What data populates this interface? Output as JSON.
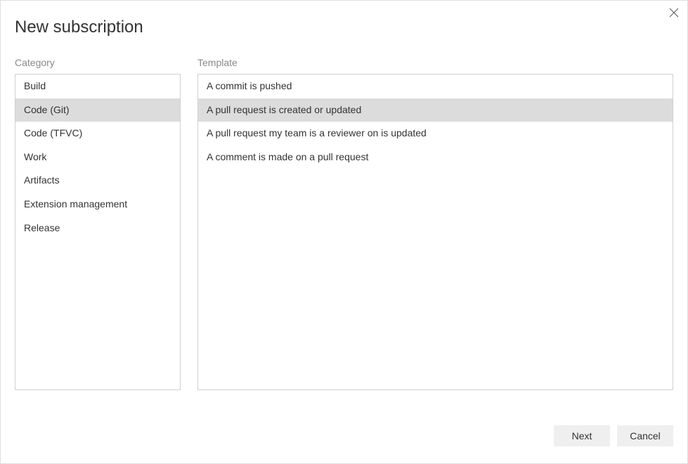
{
  "dialog": {
    "title": "New subscription",
    "category_label": "Category",
    "template_label": "Template"
  },
  "categories": [
    {
      "label": "Build",
      "selected": false
    },
    {
      "label": "Code (Git)",
      "selected": true
    },
    {
      "label": "Code (TFVC)",
      "selected": false
    },
    {
      "label": "Work",
      "selected": false
    },
    {
      "label": "Artifacts",
      "selected": false
    },
    {
      "label": "Extension management",
      "selected": false
    },
    {
      "label": "Release",
      "selected": false
    }
  ],
  "templates": [
    {
      "label": "A commit is pushed",
      "selected": false
    },
    {
      "label": "A pull request is created or updated",
      "selected": true
    },
    {
      "label": "A pull request my team is a reviewer on is updated",
      "selected": false
    },
    {
      "label": "A comment is made on a pull request",
      "selected": false
    }
  ],
  "footer": {
    "next_label": "Next",
    "cancel_label": "Cancel"
  }
}
